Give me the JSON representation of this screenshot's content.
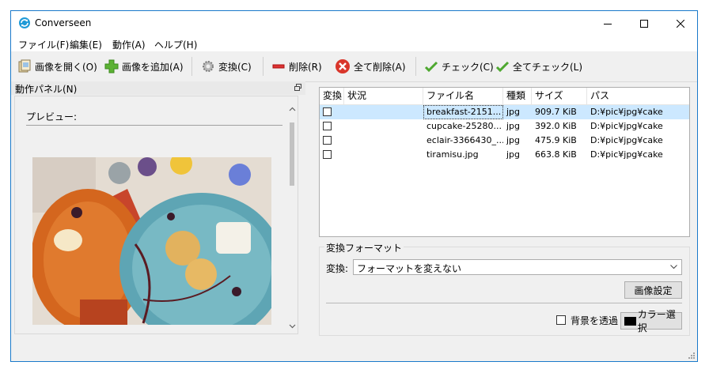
{
  "window": {
    "title": "Converseen",
    "accent": "#1979ca"
  },
  "menu": [
    "ファイル(F)",
    "編集(E)",
    "動作(A)",
    "ヘルプ(H)"
  ],
  "toolbar": {
    "open": "画像を開く(O)",
    "add": "画像を追加(A)",
    "convert": "変換(C)",
    "delete": "削除(R)",
    "delete_all": "全て削除(A)",
    "check": "チェック(C)",
    "check_all": "全てチェック(L)"
  },
  "panel": {
    "title": "動作パネル(N)",
    "preview_label": "プレビュー:"
  },
  "table": {
    "headers": [
      "変換",
      "状況",
      "ファイル名",
      "種類",
      "サイズ",
      "パス"
    ],
    "rows": [
      {
        "checked": false,
        "status": "",
        "name": "breakfast-2151...",
        "type": "jpg",
        "size": "909.7 KiB",
        "path": "D:¥pic¥jpg¥cake"
      },
      {
        "checked": false,
        "status": "",
        "name": "cupcake-25280...",
        "type": "jpg",
        "size": "392.0 KiB",
        "path": "D:¥pic¥jpg¥cake"
      },
      {
        "checked": false,
        "status": "",
        "name": "eclair-3366430_...",
        "type": "jpg",
        "size": "475.9 KiB",
        "path": "D:¥pic¥jpg¥cake"
      },
      {
        "checked": false,
        "status": "",
        "name": "tiramisu.jpg",
        "type": "jpg",
        "size": "663.8 KiB",
        "path": "D:¥pic¥jpg¥cake"
      }
    ],
    "selected_index": 0
  },
  "format": {
    "group_title": "変換フォーマット",
    "convert_label": "変換:",
    "selected": "フォーマットを変えない",
    "image_settings": "画像設定",
    "transparent_label": "背景を透過",
    "transparent_checked": false,
    "color_button": "カラー選択",
    "color_value": "#000000"
  },
  "icons": {
    "app": "converseen-icon",
    "open": "open-images-icon",
    "add": "add-plus-icon",
    "convert": "gear-icon",
    "delete": "minus-icon",
    "delete_all": "red-x-icon",
    "check": "checkmark-icon",
    "check_all": "checkmark-icon"
  }
}
